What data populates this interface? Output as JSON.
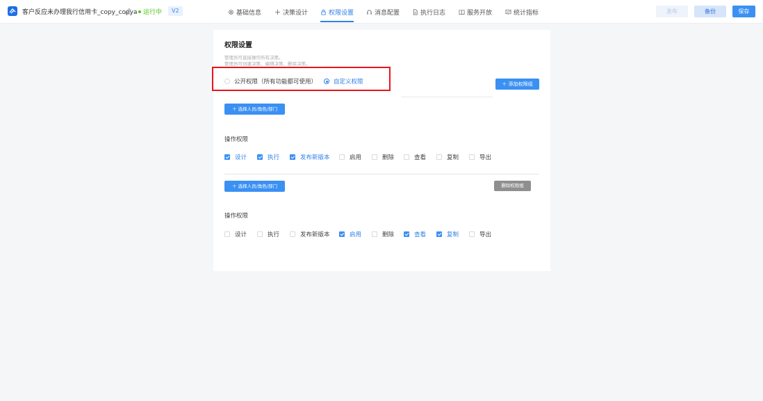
{
  "header": {
    "app_title": "客户反应未办理我行信用卡_copy_copya",
    "status": "运行中",
    "version": "V2",
    "tabs": [
      {
        "label": "基础信息",
        "icon": "gear-icon"
      },
      {
        "label": "决策设计",
        "icon": "move-icon"
      },
      {
        "label": "权限设置",
        "icon": "lock-icon",
        "active": true
      },
      {
        "label": "消息配置",
        "icon": "headset-icon"
      },
      {
        "label": "执行日志",
        "icon": "document-icon"
      },
      {
        "label": "服务开放",
        "icon": "book-icon"
      },
      {
        "label": "统计指标",
        "icon": "chart-icon"
      }
    ],
    "publish_label": "发布",
    "backup_label": "备份",
    "save_label": "保存"
  },
  "permission": {
    "title": "权限设置",
    "desc_line1": "管理员可直接操作所有决策。",
    "desc_line2": "管理员可创建决策、编辑决策、删除决策。",
    "radio_public": "公开权限（所有功能都可使用）",
    "radio_custom": "自定义权限",
    "selected": "custom",
    "add_group_label": "添加权限组",
    "groups": [
      {
        "select_label": "选择人员/角色/部门",
        "section_label": "操作权限",
        "checks": [
          {
            "label": "设计",
            "checked": true
          },
          {
            "label": "执行",
            "checked": true
          },
          {
            "label": "发布新版本",
            "checked": true
          },
          {
            "label": "启用",
            "checked": false
          },
          {
            "label": "删除",
            "checked": false
          },
          {
            "label": "查看",
            "checked": false
          },
          {
            "label": "复制",
            "checked": false
          },
          {
            "label": "导出",
            "checked": false
          }
        ]
      },
      {
        "select_label": "选择人员/角色/部门",
        "delete_label": "删除权限组",
        "section_label": "操作权限",
        "checks": [
          {
            "label": "设计",
            "checked": false
          },
          {
            "label": "执行",
            "checked": false
          },
          {
            "label": "发布新版本",
            "checked": false
          },
          {
            "label": "启用",
            "checked": true
          },
          {
            "label": "删除",
            "checked": false
          },
          {
            "label": "查看",
            "checked": true
          },
          {
            "label": "复制",
            "checked": true
          },
          {
            "label": "导出",
            "checked": false
          }
        ]
      }
    ]
  },
  "colors": {
    "accent": "#3b90f3",
    "status_green": "#52c41a",
    "highlight_red": "#e8141b"
  }
}
